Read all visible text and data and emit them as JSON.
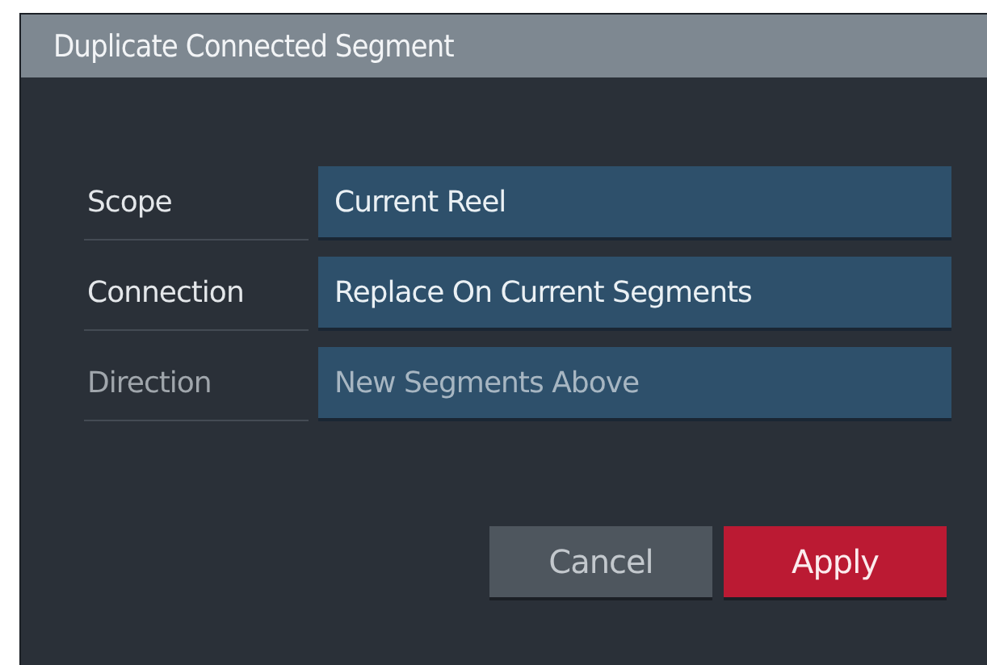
{
  "window": {
    "title": "Duplicate Connected Segment"
  },
  "fields": [
    {
      "label": "Scope",
      "value": "Current Reel",
      "disabled": false
    },
    {
      "label": "Connection",
      "value": "Replace On Current Segments",
      "disabled": false
    },
    {
      "label": "Direction",
      "value": "New Segments Above",
      "disabled": true
    }
  ],
  "buttons": [
    {
      "label": "Cancel",
      "kind": "secondary"
    },
    {
      "label": "Apply",
      "kind": "primary"
    }
  ]
}
